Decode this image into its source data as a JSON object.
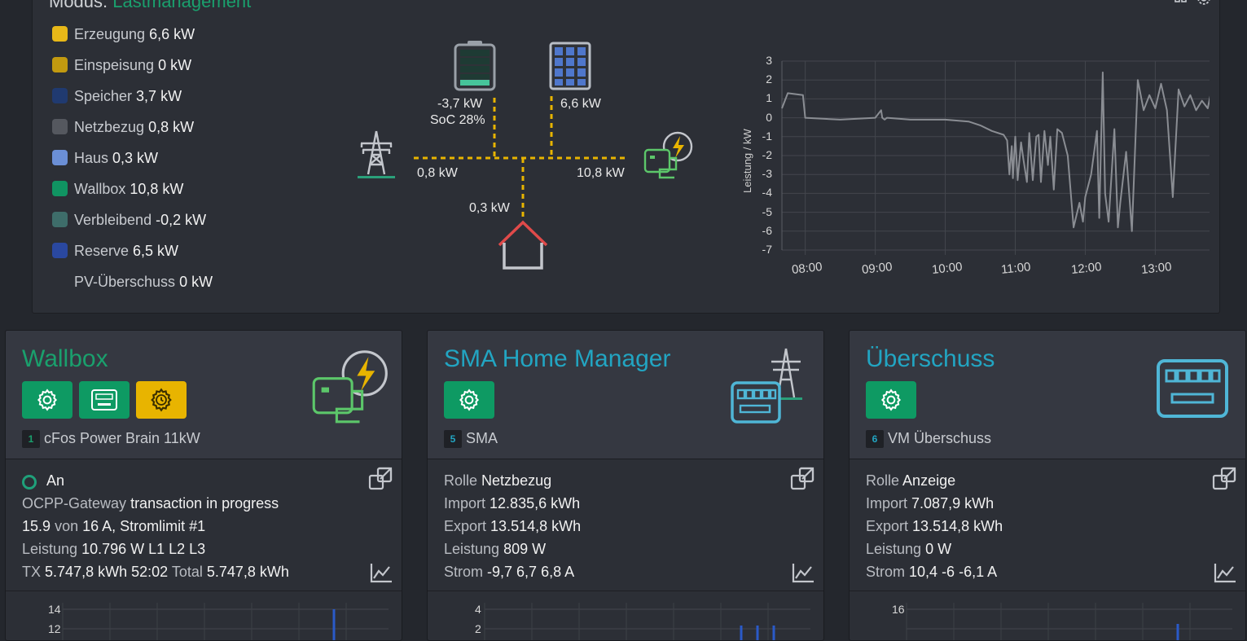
{
  "header": {
    "mode_label": "Modus:",
    "mode_value": "Lastmanagement"
  },
  "colors": {
    "accent_green": "#1aa06d",
    "teal_title": "#22a5c2",
    "flow_line": "#e8b400",
    "house_roof": "#e04a4a"
  },
  "legend": [
    {
      "label": "Erzeugung",
      "value": "6,6 kW",
      "color": "#e8b818"
    },
    {
      "label": "Einspeisung",
      "value": "0 kW",
      "color": "#c29a10"
    },
    {
      "label": "Speicher",
      "value": "3,7 kW",
      "color": "#203a70"
    },
    {
      "label": "Netzbezug",
      "value": "0,8 kW",
      "color": "#55585f"
    },
    {
      "label": "Haus",
      "value": "0,3 kW",
      "color": "#6b8fd6"
    },
    {
      "label": "Wallbox",
      "value": "10,8 kW",
      "color": "#109462"
    },
    {
      "label": "Verbleibend",
      "value": "-0,2 kW",
      "color": "#3e6d6a"
    },
    {
      "label": "Reserve",
      "value": "6,5 kW",
      "color": "#2a48a0"
    },
    {
      "label": "PV-Überschuss",
      "value": "0 kW",
      "color": ""
    }
  ],
  "flow": {
    "battery_power": "-3,7 kW",
    "battery_soc": "SoC 28%",
    "battery_soc_level": 0.28,
    "pv_power": "6,6 kW",
    "grid_power": "0,8 kW",
    "wallbox_power": "10,8 kW",
    "house_power": "0,3 kW"
  },
  "chart_data": {
    "type": "line",
    "title": "",
    "xlabel": "",
    "ylabel": "Leistung / kW",
    "xlim": [
      "07:40",
      "13:50"
    ],
    "ylim": [
      -7,
      3
    ],
    "yticks": [
      "3",
      "2",
      "1",
      "0",
      "-1",
      "-2",
      "-3",
      "-4",
      "-5",
      "-6",
      "-7"
    ],
    "xticks": [
      "08:00",
      "09:00",
      "10:00",
      "11:00",
      "12:00",
      "13:00"
    ],
    "grid": true,
    "series": [
      {
        "color": "#8a8d93",
        "x": [
          "07:40",
          "07:45",
          "07:58",
          "08:00",
          "08:30",
          "09:00",
          "09:05",
          "09:06",
          "09:08",
          "09:10",
          "09:30",
          "10:00",
          "10:20",
          "10:30",
          "10:40",
          "10:50",
          "10:53",
          "10:55",
          "10:57",
          "10:58",
          "11:00",
          "11:02",
          "11:05",
          "11:07",
          "11:10",
          "11:12",
          "11:15",
          "11:18",
          "11:20",
          "11:22",
          "11:25",
          "11:28",
          "11:30",
          "11:33",
          "11:36",
          "11:40",
          "11:45",
          "11:50",
          "11:55",
          "11:58",
          "12:00",
          "12:05",
          "12:10",
          "12:12",
          "12:15",
          "12:17",
          "12:20",
          "12:25",
          "12:28",
          "12:30",
          "12:35",
          "12:40",
          "12:45",
          "12:50",
          "12:55",
          "13:00",
          "13:05",
          "13:10",
          "13:15",
          "13:20",
          "13:25",
          "13:30",
          "13:35",
          "13:40",
          "13:45",
          "13:48"
        ],
        "y": [
          0.5,
          1.3,
          1.2,
          0,
          -0.1,
          0,
          0.4,
          0,
          -0.1,
          0,
          -0.1,
          -0.1,
          -0.2,
          -0.4,
          -0.7,
          -0.9,
          -1.2,
          -3,
          -1.5,
          -3.2,
          -1,
          -3.3,
          -1.3,
          -2.2,
          -3.4,
          -0.8,
          -3.3,
          -1,
          -0.9,
          -3.4,
          -0.7,
          -2.5,
          -1,
          -3.8,
          -0.6,
          -0.8,
          -2,
          -5.8,
          -4.5,
          -5.5,
          -4.2,
          -3,
          -0.7,
          -5.3,
          2.4,
          -4,
          -5.5,
          -0.6,
          -5.8,
          -4.5,
          -1.8,
          -6,
          2,
          0.4,
          1.2,
          0.5,
          1.8,
          0.4,
          -4.2,
          1.5,
          0.6,
          1.2,
          0.4,
          0.9,
          0.5,
          1.4
        ]
      }
    ]
  },
  "cards": [
    {
      "title": "Wallbox",
      "badge": "1",
      "device": "cFos Power Brain 11kW",
      "status": "An",
      "rows": [
        [
          {
            "k": "OCPP-Gateway",
            "v": "transaction in progress"
          }
        ],
        [
          {
            "k": "",
            "v": "15.9"
          },
          {
            "k": "von",
            "v": "16 A, Stromlimit #1"
          }
        ],
        [
          {
            "k": "Leistung",
            "v": "10.796 W L1 L2 L3"
          }
        ],
        [
          {
            "k": "TX",
            "v": "5.747,8 kWh 52:02"
          },
          {
            "k": "Total",
            "v": "5.747,8 kWh"
          }
        ]
      ],
      "mini_ticks": [
        "14",
        "12"
      ]
    },
    {
      "title": "SMA Home Manager",
      "badge": "5",
      "device": "SMA",
      "rows": [
        [
          {
            "k": "Rolle",
            "v": "Netzbezug"
          }
        ],
        [
          {
            "k": "Import",
            "v": "12.835,6 kWh"
          }
        ],
        [
          {
            "k": "Export",
            "v": "13.514,8 kWh"
          }
        ],
        [
          {
            "k": "Leistung",
            "v": "809 W"
          }
        ],
        [
          {
            "k": "Strom",
            "v": "-9,7 6,7 6,8 A"
          }
        ]
      ],
      "mini_ticks": [
        "4",
        "2"
      ]
    },
    {
      "title": "Überschuss",
      "badge": "6",
      "device": "VM Überschuss",
      "rows": [
        [
          {
            "k": "Rolle",
            "v": "Anzeige"
          }
        ],
        [
          {
            "k": "Import",
            "v": "7.087,9 kWh"
          }
        ],
        [
          {
            "k": "Export",
            "v": "13.514,8 kWh"
          }
        ],
        [
          {
            "k": "Leistung",
            "v": "0 W"
          }
        ],
        [
          {
            "k": "Strom",
            "v": "10,4 -6 -6,1 A"
          }
        ]
      ],
      "mini_ticks": [
        "16"
      ]
    }
  ]
}
